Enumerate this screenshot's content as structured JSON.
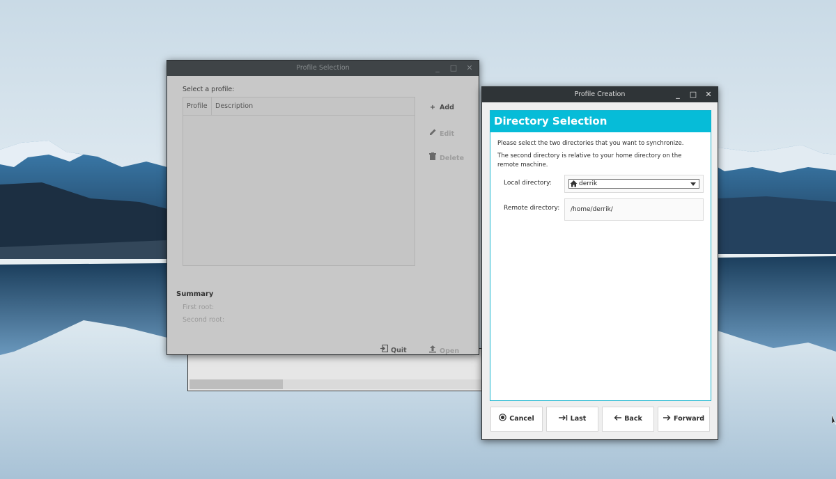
{
  "parent_window": {
    "title": "Profile Selection",
    "select_label": "Select a profile:",
    "columns": [
      "Profile",
      "Description"
    ],
    "actions": {
      "add": "Add",
      "edit": "Edit",
      "delete": "Delete"
    },
    "summary_label": "Summary",
    "first_root_label": "First root:",
    "second_root_label": "Second root:",
    "quit_label": "Quit",
    "open_label": "Open"
  },
  "dialog": {
    "title": "Profile Creation",
    "header": "Directory Selection",
    "instruction_1": "Please select the two directories that you want to synchronize.",
    "instruction_2": "The second directory is relative to your home directory on the remote machine.",
    "local_label": "Local directory:",
    "local_value": "derrik",
    "remote_label": "Remote directory:",
    "remote_value": "/home/derrik/",
    "buttons": {
      "cancel": "Cancel",
      "last": "Last",
      "back": "Back",
      "forward": "Forward"
    },
    "accent_color": "#06bcd8"
  },
  "window_controls": {
    "minimize": "_",
    "maximize": "□",
    "close": "✕"
  }
}
